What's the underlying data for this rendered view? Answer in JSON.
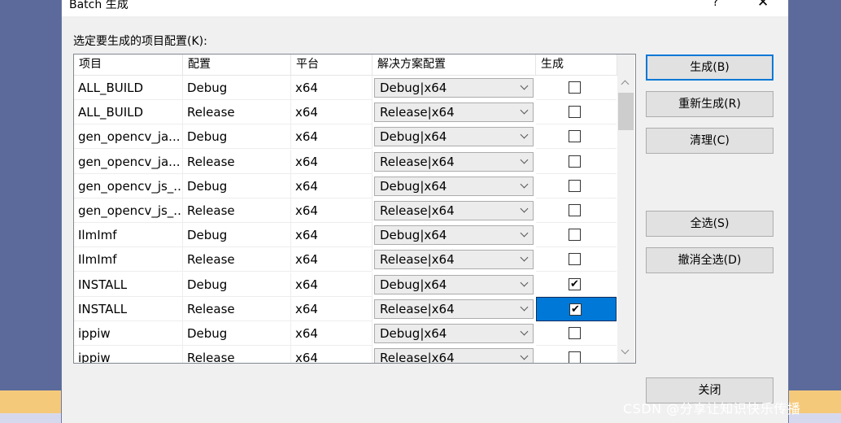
{
  "dialog": {
    "title": "Batch 生成",
    "help": "?",
    "close": "✕",
    "prompt": "选定要生成的项目配置(K):"
  },
  "columns": [
    "项目",
    "配置",
    "平台",
    "解决方案配置",
    "生成"
  ],
  "rows": [
    {
      "project": "ALL_BUILD",
      "config": "Debug",
      "platform": "x64",
      "solution": "Debug|x64",
      "build": false
    },
    {
      "project": "ALL_BUILD",
      "config": "Release",
      "platform": "x64",
      "solution": "Release|x64",
      "build": false
    },
    {
      "project": "gen_opencv_ja...",
      "config": "Debug",
      "platform": "x64",
      "solution": "Debug|x64",
      "build": false
    },
    {
      "project": "gen_opencv_ja...",
      "config": "Release",
      "platform": "x64",
      "solution": "Release|x64",
      "build": false
    },
    {
      "project": "gen_opencv_js_...",
      "config": "Debug",
      "platform": "x64",
      "solution": "Debug|x64",
      "build": false
    },
    {
      "project": "gen_opencv_js_...",
      "config": "Release",
      "platform": "x64",
      "solution": "Release|x64",
      "build": false
    },
    {
      "project": "IlmImf",
      "config": "Debug",
      "platform": "x64",
      "solution": "Debug|x64",
      "build": false
    },
    {
      "project": "IlmImf",
      "config": "Release",
      "platform": "x64",
      "solution": "Release|x64",
      "build": false
    },
    {
      "project": "INSTALL",
      "config": "Debug",
      "platform": "x64",
      "solution": "Debug|x64",
      "build": true
    },
    {
      "project": "INSTALL",
      "config": "Release",
      "platform": "x64",
      "solution": "Release|x64",
      "build": true,
      "selected": true
    },
    {
      "project": "ippiw",
      "config": "Debug",
      "platform": "x64",
      "solution": "Debug|x64",
      "build": false
    },
    {
      "project": "ippiw",
      "config": "Release",
      "platform": "x64",
      "solution": "Release|x64",
      "build": false
    }
  ],
  "buttons": {
    "build": "生成(B)",
    "rebuild": "重新生成(R)",
    "clean": "清理(C)",
    "select_all": "全选(S)",
    "deselect_all": "撤消全选(D)",
    "close": "关闭"
  },
  "watermark": "CSDN @分享让知识快乐传播",
  "colors": {
    "selection": "#0078d7",
    "default_button_border": "#0078d7"
  }
}
